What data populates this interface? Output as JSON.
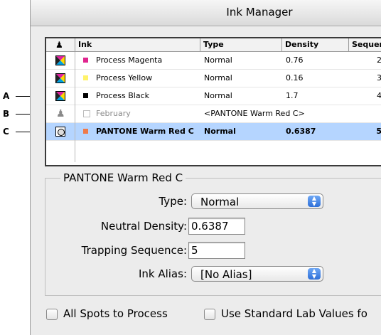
{
  "callouts": {
    "a": "A",
    "b": "B",
    "c": "C"
  },
  "window": {
    "title": "Ink Manager"
  },
  "table": {
    "headers": {
      "icon": "",
      "ink": "Ink",
      "type": "Type",
      "density": "Density",
      "sequence": "Sequen"
    },
    "rows": [
      {
        "icon": "process-color-icon",
        "swatch": "#e0258f",
        "ink": "Process Magenta",
        "type": "Normal",
        "density": "0.76",
        "sequence": "2"
      },
      {
        "icon": "process-color-icon",
        "swatch": "#fff36a",
        "ink": "Process Yellow",
        "type": "Normal",
        "density": "0.16",
        "sequence": "3"
      },
      {
        "icon": "process-color-icon",
        "swatch": "#000000",
        "ink": "Process Black",
        "type": "Normal",
        "density": "1.7",
        "sequence": "4"
      },
      {
        "icon": "ink-alias-icon",
        "swatch": "",
        "ink": "February",
        "type": "<PANTONE Warm Red C>",
        "density": "",
        "sequence": ""
      },
      {
        "icon": "spot-color-icon",
        "swatch": "#ef7a4a",
        "ink": "PANTONE Warm Red C",
        "type": "Normal",
        "density": "0.6387",
        "sequence": "5"
      }
    ]
  },
  "details": {
    "group_title": "PANTONE Warm Red C",
    "type_label": "Type:",
    "type_value": "Normal",
    "neutral_density_label": "Neutral Density:",
    "neutral_density_value": "0.6387",
    "trapping_sequence_label": "Trapping Sequence:",
    "trapping_sequence_value": "5",
    "ink_alias_label": "Ink Alias:",
    "ink_alias_value": "[No Alias]"
  },
  "options": {
    "all_spots_label": "All Spots to Process",
    "standard_lab_label": "Use Standard Lab Values fo"
  }
}
